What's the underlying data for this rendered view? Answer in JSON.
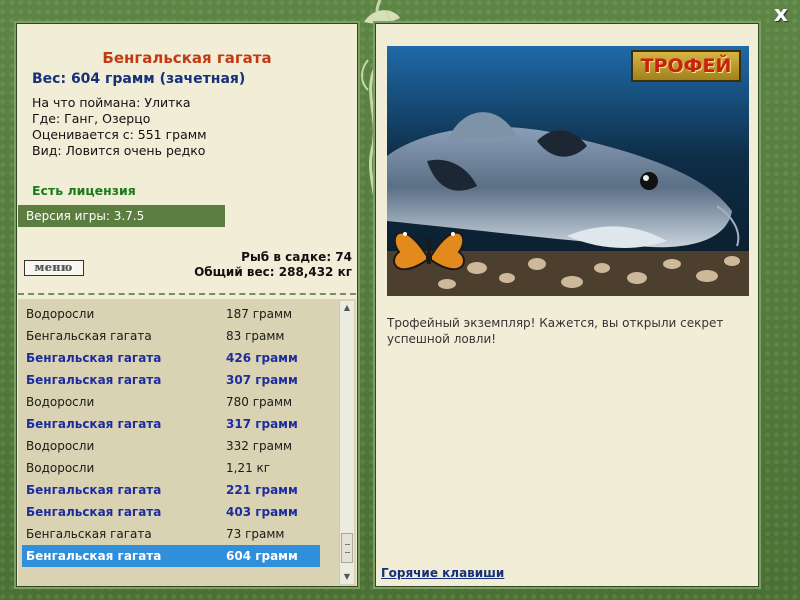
{
  "close_label": "x",
  "fish": {
    "name": "Бенгальская гагата",
    "weight_line": "Вес: 604 грамм (зачетная)",
    "bait_line": "На что поймана: Улитка",
    "location_line": "Где: Ганг, Озерцо",
    "rated_line": "Оценивается с: 551 грамм",
    "rarity_line": "Вид: Ловится очень редко"
  },
  "license_text": "Есть лицензия",
  "version_text": "Версия игры: 3.7.5",
  "menu_label": "меню",
  "stats": {
    "fish_count_line": "Рыб в садке: 74",
    "total_weight_line": "Общий вес: 288,432 кг"
  },
  "catch_list": [
    {
      "name": "Водоросли",
      "weight": "187 грамм",
      "trophy": false,
      "selected": false
    },
    {
      "name": "Бенгальская гагата",
      "weight": "83 грамм",
      "trophy": false,
      "selected": false
    },
    {
      "name": "Бенгальская гагата",
      "weight": "426 грамм",
      "trophy": true,
      "selected": false
    },
    {
      "name": "Бенгальская гагата",
      "weight": "307 грамм",
      "trophy": true,
      "selected": false
    },
    {
      "name": "Водоросли",
      "weight": "780 грамм",
      "trophy": false,
      "selected": false
    },
    {
      "name": "Бенгальская гагата",
      "weight": "317 грамм",
      "trophy": true,
      "selected": false
    },
    {
      "name": "Водоросли",
      "weight": "332 грамм",
      "trophy": false,
      "selected": false
    },
    {
      "name": "Водоросли",
      "weight": "1,21 кг",
      "trophy": false,
      "selected": false
    },
    {
      "name": "Бенгальская гагата",
      "weight": "221 грамм",
      "trophy": true,
      "selected": false
    },
    {
      "name": "Бенгальская гагата",
      "weight": "403 грамм",
      "trophy": true,
      "selected": false
    },
    {
      "name": "Бенгальская гагата",
      "weight": "73 грамм",
      "trophy": false,
      "selected": false
    },
    {
      "name": "Бенгальская гагата",
      "weight": "604 грамм",
      "trophy": true,
      "selected": true
    }
  ],
  "trophy_badge": "ТРОФЕЙ",
  "description": "Трофейный экземпляр! Кажется, вы открыли секрет успешной ловли!",
  "hotkeys_link": "Горячие клавиши",
  "colors": {
    "frame_green": "#547a3c",
    "panel_bg": "#f1edd7",
    "fish_name": "#c23a13",
    "trophy_row": "#1d2d9c",
    "selected_row": "#2f8fdb",
    "license": "#1b7a1b"
  }
}
